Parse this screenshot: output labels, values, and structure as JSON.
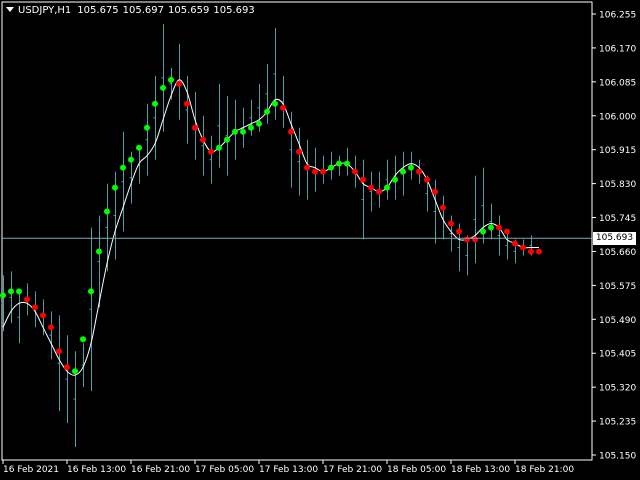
{
  "header": {
    "symbol": "USDJPY,H1",
    "open": "105.675",
    "high": "105.697",
    "low": "105.659",
    "close": "105.693"
  },
  "current_price_label": "105.693",
  "colors": {
    "background": "#000000",
    "axis": "#FFFFFF",
    "candle_wick": "#4F9DA8",
    "ma_line": "#FFFFFF",
    "bull_dot": "#00FF00",
    "bear_dot": "#FF0000",
    "price_line": "#7FA7B0"
  },
  "chart_data": {
    "type": "line",
    "title": "",
    "xlabel": "",
    "ylabel": "",
    "ylim": [
      105.15,
      106.265
    ],
    "current_price": 105.693,
    "y_ticks": [
      "106.255",
      "106.170",
      "106.085",
      "106.000",
      "105.915",
      "105.830",
      "105.745",
      "105.660",
      "105.575",
      "105.490",
      "105.405",
      "105.320",
      "105.235",
      "105.150"
    ],
    "x_ticks": [
      "16 Feb 2021",
      "16 Feb 13:00",
      "16 Feb 21:00",
      "17 Feb 05:00",
      "17 Feb 13:00",
      "17 Feb 21:00",
      "18 Feb 05:00",
      "18 Feb 13:00",
      "18 Feb 21:00"
    ],
    "bar_count": 68,
    "bars_per_tick": 8,
    "wicks": [
      [
        0,
        105.46,
        105.6
      ],
      [
        1,
        105.48,
        105.61
      ],
      [
        2,
        105.43,
        105.56
      ],
      [
        3,
        105.5,
        105.58
      ],
      [
        4,
        105.47,
        105.56
      ],
      [
        5,
        105.45,
        105.54
      ],
      [
        6,
        105.39,
        105.51
      ],
      [
        7,
        105.26,
        105.5
      ],
      [
        8,
        105.23,
        105.45
      ],
      [
        9,
        105.17,
        105.41
      ],
      [
        10,
        105.32,
        105.43
      ],
      [
        11,
        105.31,
        105.72
      ],
      [
        12,
        105.52,
        105.75
      ],
      [
        13,
        105.61,
        105.83
      ],
      [
        14,
        105.64,
        105.86
      ],
      [
        15,
        105.71,
        105.96
      ],
      [
        16,
        105.78,
        105.91
      ],
      [
        17,
        105.83,
        105.92
      ],
      [
        18,
        105.85,
        106.03
      ],
      [
        19,
        105.89,
        106.1
      ],
      [
        20,
        105.96,
        106.23
      ],
      [
        21,
        106.04,
        106.12
      ],
      [
        22,
        105.99,
        106.18
      ],
      [
        23,
        105.93,
        106.1
      ],
      [
        24,
        105.89,
        106.06
      ],
      [
        25,
        105.85,
        106.0
      ],
      [
        26,
        105.83,
        105.95
      ],
      [
        27,
        105.87,
        106.08
      ],
      [
        28,
        105.85,
        106.05
      ],
      [
        29,
        105.89,
        106.04
      ],
      [
        30,
        105.92,
        106.02
      ],
      [
        31,
        105.95,
        106.04
      ],
      [
        32,
        105.96,
        106.08
      ],
      [
        33,
        105.98,
        106.13
      ],
      [
        34,
        105.99,
        106.22
      ],
      [
        35,
        105.97,
        106.1
      ],
      [
        36,
        105.82,
        106.01
      ],
      [
        37,
        105.8,
        105.97
      ],
      [
        38,
        105.79,
        105.94
      ],
      [
        39,
        105.81,
        105.92
      ],
      [
        40,
        105.83,
        105.9
      ],
      [
        41,
        105.84,
        105.91
      ],
      [
        42,
        105.85,
        105.9
      ],
      [
        43,
        105.85,
        105.92
      ],
      [
        44,
        105.82,
        105.9
      ],
      [
        45,
        105.69,
        105.89
      ],
      [
        46,
        105.76,
        105.86
      ],
      [
        47,
        105.77,
        105.86
      ],
      [
        48,
        105.79,
        105.89
      ],
      [
        49,
        105.79,
        105.9
      ],
      [
        50,
        105.8,
        105.91
      ],
      [
        51,
        105.84,
        105.91
      ],
      [
        52,
        105.83,
        105.89
      ],
      [
        53,
        105.76,
        105.85
      ],
      [
        54,
        105.68,
        105.84
      ],
      [
        55,
        105.69,
        105.8
      ],
      [
        56,
        105.66,
        105.75
      ],
      [
        57,
        105.61,
        105.73
      ],
      [
        58,
        105.6,
        105.7
      ],
      [
        59,
        105.63,
        105.85
      ],
      [
        60,
        105.68,
        105.87
      ],
      [
        61,
        105.69,
        105.78
      ],
      [
        62,
        105.65,
        105.75
      ],
      [
        63,
        105.64,
        105.71
      ],
      [
        64,
        105.63,
        105.69
      ],
      [
        65,
        105.65,
        105.69
      ],
      [
        66,
        105.65,
        105.7
      ]
    ],
    "series": [
      {
        "values": [
          [
            0,
            105.47
          ],
          [
            1,
            105.51
          ],
          [
            2,
            105.53
          ],
          [
            3,
            105.53
          ],
          [
            4,
            105.51
          ],
          [
            5,
            105.47
          ],
          [
            6,
            105.43
          ],
          [
            7,
            105.39
          ],
          [
            8,
            105.36
          ],
          [
            9,
            105.35
          ],
          [
            10,
            105.37
          ],
          [
            11,
            105.43
          ],
          [
            12,
            105.53
          ],
          [
            13,
            105.63
          ],
          [
            14,
            105.71
          ],
          [
            15,
            105.77
          ],
          [
            16,
            105.83
          ],
          [
            17,
            105.88
          ],
          [
            18,
            105.9
          ],
          [
            19,
            105.93
          ],
          [
            20,
            105.99
          ],
          [
            21,
            106.05
          ],
          [
            22,
            106.09
          ],
          [
            23,
            106.06
          ],
          [
            24,
            105.99
          ],
          [
            25,
            105.94
          ],
          [
            26,
            105.91
          ],
          [
            27,
            105.92
          ],
          [
            28,
            105.94
          ],
          [
            29,
            105.96
          ],
          [
            30,
            105.97
          ],
          [
            31,
            105.98
          ],
          [
            32,
            105.99
          ],
          [
            33,
            106.01
          ],
          [
            34,
            106.04
          ],
          [
            35,
            106.03
          ],
          [
            36,
            105.98
          ],
          [
            37,
            105.93
          ],
          [
            38,
            105.88
          ],
          [
            39,
            105.87
          ],
          [
            40,
            105.86
          ],
          [
            41,
            105.87
          ],
          [
            42,
            105.88
          ],
          [
            43,
            105.88
          ],
          [
            44,
            105.86
          ],
          [
            45,
            105.83
          ],
          [
            46,
            105.82
          ],
          [
            47,
            105.81
          ],
          [
            48,
            105.82
          ],
          [
            49,
            105.85
          ],
          [
            50,
            105.87
          ],
          [
            51,
            105.88
          ],
          [
            52,
            105.87
          ],
          [
            53,
            105.84
          ],
          [
            54,
            105.79
          ],
          [
            55,
            105.74
          ],
          [
            56,
            105.71
          ],
          [
            57,
            105.69
          ],
          [
            58,
            105.69
          ],
          [
            59,
            105.7
          ],
          [
            60,
            105.72
          ],
          [
            61,
            105.73
          ],
          [
            62,
            105.72
          ],
          [
            63,
            105.69
          ],
          [
            64,
            105.68
          ],
          [
            65,
            105.67
          ],
          [
            66,
            105.67
          ],
          [
            67,
            105.67
          ]
        ]
      }
    ],
    "signal_dots": [
      [
        0,
        105.55,
        "bull"
      ],
      [
        1,
        105.56,
        "bull"
      ],
      [
        2,
        105.56,
        "bull"
      ],
      [
        3,
        105.54,
        "bear"
      ],
      [
        4,
        105.52,
        "bear"
      ],
      [
        5,
        105.5,
        "bear"
      ],
      [
        6,
        105.47,
        "bear"
      ],
      [
        7,
        105.41,
        "bear"
      ],
      [
        8,
        105.37,
        "bear"
      ],
      [
        9,
        105.36,
        "bull"
      ],
      [
        10,
        105.44,
        "bull"
      ],
      [
        11,
        105.56,
        "bull"
      ],
      [
        12,
        105.66,
        "bull"
      ],
      [
        13,
        105.76,
        "bull"
      ],
      [
        14,
        105.82,
        "bull"
      ],
      [
        15,
        105.87,
        "bull"
      ],
      [
        16,
        105.89,
        "bull"
      ],
      [
        17,
        105.92,
        "bull"
      ],
      [
        18,
        105.97,
        "bull"
      ],
      [
        19,
        106.03,
        "bull"
      ],
      [
        20,
        106.07,
        "bull"
      ],
      [
        21,
        106.09,
        "bull"
      ],
      [
        22,
        106.08,
        "bear"
      ],
      [
        23,
        106.03,
        "bear"
      ],
      [
        24,
        105.97,
        "bear"
      ],
      [
        25,
        105.94,
        "bear"
      ],
      [
        26,
        105.91,
        "bear"
      ],
      [
        27,
        105.92,
        "bull"
      ],
      [
        28,
        105.94,
        "bull"
      ],
      [
        29,
        105.96,
        "bull"
      ],
      [
        30,
        105.96,
        "bull"
      ],
      [
        31,
        105.97,
        "bull"
      ],
      [
        32,
        105.98,
        "bull"
      ],
      [
        33,
        106.01,
        "bull"
      ],
      [
        34,
        106.03,
        "bull"
      ],
      [
        35,
        106.02,
        "bear"
      ],
      [
        36,
        105.96,
        "bear"
      ],
      [
        37,
        105.91,
        "bear"
      ],
      [
        38,
        105.87,
        "bear"
      ],
      [
        39,
        105.86,
        "bear"
      ],
      [
        40,
        105.86,
        "bear"
      ],
      [
        41,
        105.87,
        "bull"
      ],
      [
        42,
        105.88,
        "bull"
      ],
      [
        43,
        105.88,
        "bull"
      ],
      [
        44,
        105.86,
        "bear"
      ],
      [
        45,
        105.84,
        "bear"
      ],
      [
        46,
        105.82,
        "bear"
      ],
      [
        47,
        105.81,
        "bear"
      ],
      [
        48,
        105.82,
        "bull"
      ],
      [
        49,
        105.84,
        "bull"
      ],
      [
        50,
        105.86,
        "bull"
      ],
      [
        51,
        105.87,
        "bull"
      ],
      [
        52,
        105.86,
        "bear"
      ],
      [
        53,
        105.84,
        "bear"
      ],
      [
        54,
        105.81,
        "bear"
      ],
      [
        55,
        105.77,
        "bear"
      ],
      [
        56,
        105.73,
        "bear"
      ],
      [
        57,
        105.71,
        "bear"
      ],
      [
        58,
        105.69,
        "bear"
      ],
      [
        59,
        105.69,
        "bear"
      ],
      [
        60,
        105.71,
        "bull"
      ],
      [
        61,
        105.72,
        "bull"
      ],
      [
        62,
        105.72,
        "bear"
      ],
      [
        63,
        105.71,
        "bear"
      ],
      [
        64,
        105.68,
        "bear"
      ],
      [
        65,
        105.67,
        "bear"
      ],
      [
        66,
        105.66,
        "bear"
      ],
      [
        67,
        105.66,
        "bear"
      ]
    ]
  }
}
